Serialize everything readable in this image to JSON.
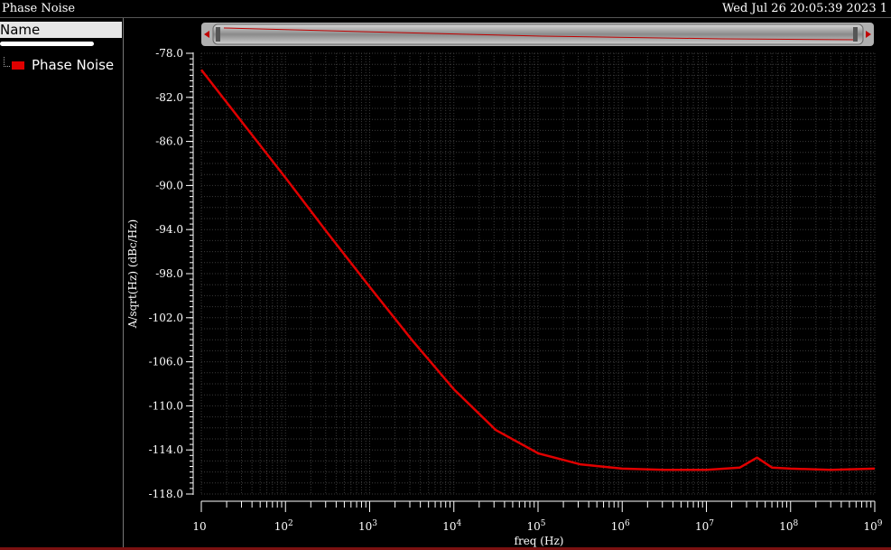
{
  "window": {
    "title": "Phase Noise",
    "datetime": "Wed Jul 26 20:05:39 2023  1"
  },
  "sidebar": {
    "header": "Name",
    "legend": [
      {
        "label": "Phase Noise",
        "color": "#e00000"
      }
    ]
  },
  "colors": {
    "background": "#000000",
    "grid": "#3a3a3a",
    "trace": "#e00000",
    "axis": "#ffffff"
  },
  "chart_data": {
    "type": "line",
    "xlabel": "freq (Hz)",
    "ylabel": "A/sqrt(Hz) (dBc/Hz)",
    "xscale": "log",
    "xlim": [
      10,
      1000000000
    ],
    "ylim": [
      -118,
      -78
    ],
    "x_ticks": [
      "10",
      "10^2",
      "10^3",
      "10^4",
      "10^5",
      "10^6",
      "10^7",
      "10^8",
      "10^9"
    ],
    "y_ticks": [
      "-78.0",
      "-82.0",
      "-86.0",
      "-90.0",
      "-94.0",
      "-98.0",
      "-102.0",
      "-106.0",
      "-110.0",
      "-114.0",
      "-118.0"
    ],
    "grid": true,
    "series": [
      {
        "name": "Phase Noise",
        "color": "#e00000",
        "x": [
          10,
          31.6,
          100,
          316,
          1000,
          3160,
          10000,
          31600,
          100000,
          316000,
          1000000,
          3160000,
          10000000,
          25000000,
          40000000,
          60000000,
          100000000,
          300000000,
          1000000000
        ],
        "y": [
          -79.5,
          -84.4,
          -89.3,
          -94.3,
          -99.2,
          -104.0,
          -108.5,
          -112.2,
          -114.3,
          -115.3,
          -115.7,
          -115.8,
          -115.8,
          -115.6,
          -114.7,
          -115.6,
          -115.7,
          -115.8,
          -115.7
        ]
      }
    ]
  }
}
